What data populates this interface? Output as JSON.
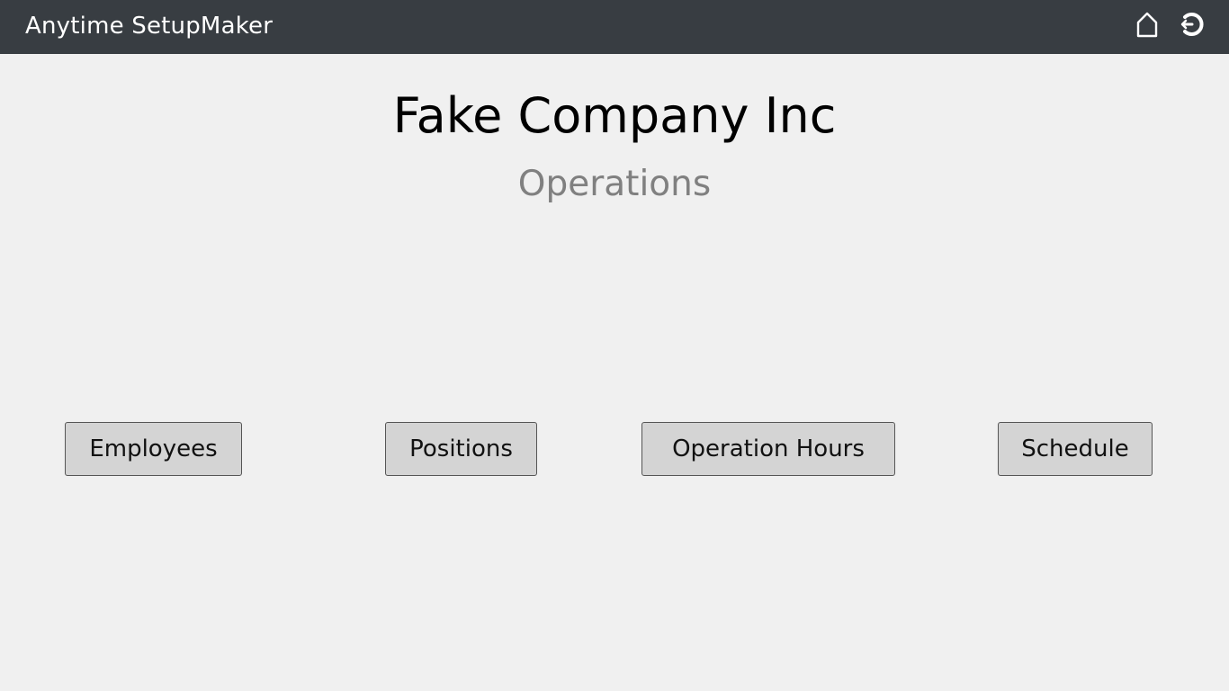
{
  "app": {
    "title": "Anytime SetupMaker"
  },
  "header": {
    "icons": [
      "home-icon",
      "logout-icon"
    ]
  },
  "main": {
    "company_name": "Fake Company Inc",
    "section_title": "Operations",
    "buttons": [
      {
        "label": "Employees"
      },
      {
        "label": "Positions"
      },
      {
        "label": "Operation Hours"
      },
      {
        "label": "Schedule"
      }
    ]
  },
  "colors": {
    "topbar": "#383d42",
    "background": "#f0f0f0",
    "button_bg": "#d4d4d4",
    "subtitle": "#808080"
  }
}
